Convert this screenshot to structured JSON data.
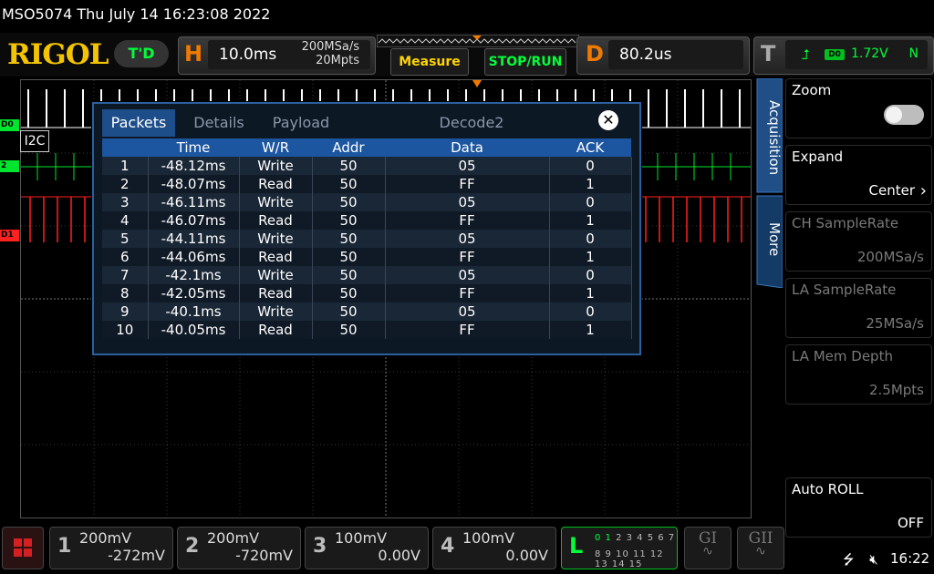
{
  "title_bar": {
    "text": "MSO5074  Thu July 14 16:23:08 2022"
  },
  "toolbar": {
    "logo": "RIGOL",
    "td_badge": "T'D",
    "horizontal": {
      "letter": "H",
      "timebase": "10.0ms",
      "sample_rate": "200MSa/s",
      "memory": "20Mpts"
    },
    "measure_label": "Measure",
    "stop_run_label": "STOP/RUN",
    "delay": {
      "letter": "D",
      "value": "80.2us"
    },
    "trigger": {
      "letter": "T",
      "source": "D0",
      "level": "1.72V",
      "mode": "N"
    }
  },
  "waveform": {
    "channel_labels": [
      "D0",
      "2",
      "D1"
    ],
    "decode_tag": "I2C",
    "colors": {
      "d0": "#ffffff",
      "ch2": "#00e62e",
      "d1": "#ff2020"
    }
  },
  "decode_dialog": {
    "tabs": [
      "Packets",
      "Details",
      "Payload",
      "Decode2"
    ],
    "active_tab": "Packets",
    "columns": [
      "",
      "Time",
      "W/R",
      "Addr",
      "Data",
      "ACK"
    ],
    "rows": [
      [
        "1",
        "-48.12ms",
        "Write",
        "50",
        "05",
        "0"
      ],
      [
        "2",
        "-48.07ms",
        "Read",
        "50",
        "FF",
        "1"
      ],
      [
        "3",
        "-46.11ms",
        "Write",
        "50",
        "05",
        "0"
      ],
      [
        "4",
        "-46.07ms",
        "Read",
        "50",
        "FF",
        "1"
      ],
      [
        "5",
        "-44.11ms",
        "Write",
        "50",
        "05",
        "0"
      ],
      [
        "6",
        "-44.06ms",
        "Read",
        "50",
        "FF",
        "1"
      ],
      [
        "7",
        "-42.1ms",
        "Write",
        "50",
        "05",
        "0"
      ],
      [
        "8",
        "-42.05ms",
        "Read",
        "50",
        "FF",
        "1"
      ],
      [
        "9",
        "-40.1ms",
        "Write",
        "50",
        "05",
        "0"
      ],
      [
        "10",
        "-40.05ms",
        "Read",
        "50",
        "FF",
        "1"
      ]
    ]
  },
  "side_menu": {
    "vertical_tabs": [
      "Acquisition",
      "More"
    ],
    "items": [
      {
        "label": "Zoom",
        "value": "",
        "toggle": false
      },
      {
        "label": "Expand",
        "value": "Center"
      },
      {
        "label": "CH SampleRate",
        "value": "200MSa/s"
      },
      {
        "label": "LA SampleRate",
        "value": "25MSa/s"
      },
      {
        "label": "LA Mem Depth",
        "value": "2.5Mpts"
      },
      {
        "label": "Auto ROLL",
        "value": "OFF"
      }
    ]
  },
  "bottom_bar": {
    "channels": [
      {
        "num": "1",
        "scale": "200mV",
        "offset": "-272mV"
      },
      {
        "num": "2",
        "scale": "200mV",
        "offset": "-720mV"
      },
      {
        "num": "3",
        "scale": "100mV",
        "offset": "0.00V"
      },
      {
        "num": "4",
        "scale": "100mV",
        "offset": "0.00V"
      }
    ],
    "la": {
      "letter": "L",
      "row1": "0 1 2 3  4 5 6 7",
      "row2": "8 9 10 11 12 13 14 15"
    },
    "gen1": "GI",
    "gen2": "GII",
    "time": "16:22"
  }
}
